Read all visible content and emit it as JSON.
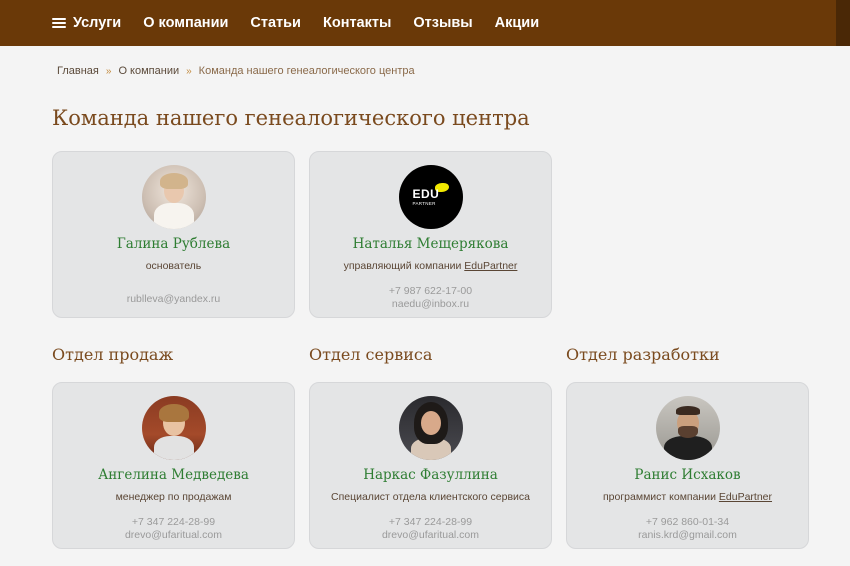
{
  "nav": {
    "items": [
      "Услуги",
      "О компании",
      "Статьи",
      "Контакты",
      "Отзывы",
      "Акции"
    ]
  },
  "breadcrumb": {
    "items": [
      "Главная",
      "О компании"
    ],
    "current": "Команда нашего генеалогического центра",
    "separator": "»"
  },
  "page_title": "Команда нашего генеалогического центра",
  "leaders": [
    {
      "name": "Галина Рублева",
      "role": "основатель",
      "phone": "",
      "email": "rublleva@yandex.ru",
      "avatar": "photo-woman-white-blouse"
    },
    {
      "name": "Наталья Мещерякова",
      "role": "управляющий компании",
      "role_link": "EduPartner",
      "phone": "+7 987 622-17-00",
      "email": "naedu@inbox.ru",
      "avatar": "edupartner-logo",
      "logo_text": "EDU",
      "logo_subtext": "PARTNER"
    }
  ],
  "sections": [
    {
      "title": "Отдел продаж",
      "member": {
        "name": "Ангелина Медведева",
        "role": "менеджер по продажам",
        "phone": "+7 347 224-28-99",
        "email": "drevo@ufaritual.com",
        "avatar": "photo-woman-brick-wall"
      }
    },
    {
      "title": "Отдел сервиса",
      "member": {
        "name": "Наркас Фазуллина",
        "role": "Специалист отдела клиентского сервиса",
        "phone": "+7 347 224-28-99",
        "email": "drevo@ufaritual.com",
        "avatar": "photo-woman-dark-hair"
      }
    },
    {
      "title": "Отдел разработки",
      "member": {
        "name": "Ранис Исхаков",
        "role": "программист компании",
        "role_link": "EduPartner",
        "phone": "+7 962 860-01-34",
        "email": "ranis.krd@gmail.com",
        "avatar": "photo-man-beard"
      }
    }
  ],
  "colors": {
    "nav_bg": "#6a3908",
    "title": "#7a4a1e",
    "name": "#2e7d32",
    "card_bg": "#e4e5e6",
    "page_bg": "#f4f4f4"
  }
}
